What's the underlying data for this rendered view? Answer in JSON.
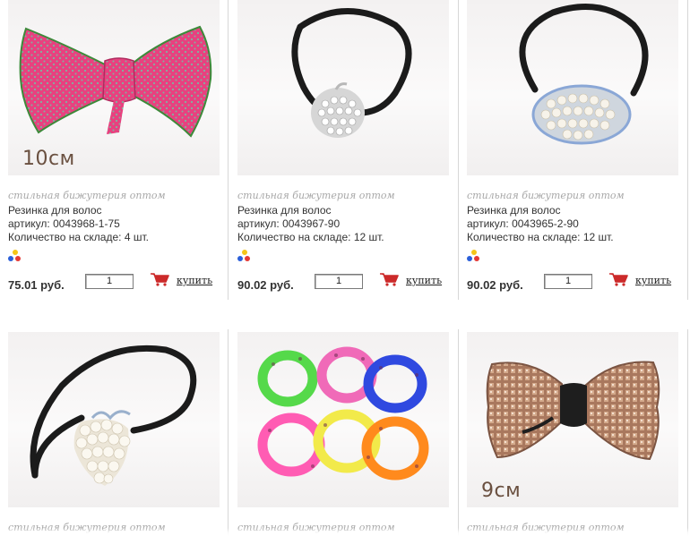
{
  "products": [
    {
      "tagline": "стильная бижутерия оптом",
      "name": "Резинка для волос",
      "article": "артикул: 0043968-1-75",
      "stock": "Количество на складе: 4 шт.",
      "price": "75.01 руб.",
      "qty": "1",
      "buy_label": "купить",
      "size_label": "10см",
      "image": "pink-polka-dot-bow"
    },
    {
      "tagline": "стильная бижутерия оптом",
      "name": "Резинка для волос",
      "article": "артикул: 0043967-90",
      "stock": "Количество на складе: 12 шт.",
      "price": "90.02 руб.",
      "qty": "1",
      "buy_label": "купить",
      "image": "black-elastic-crystal-apple"
    },
    {
      "tagline": "стильная бижутерия оптом",
      "name": "Резинка для волос",
      "article": "артикул: 0043965-2-90",
      "stock": "Количество на складе: 12 шт.",
      "price": "90.02 руб.",
      "qty": "1",
      "buy_label": "купить",
      "image": "black-elastic-pearl-oval"
    },
    {
      "tagline": "стильная бижутерия оптом",
      "image": "black-elastic-pearl-strawberry"
    },
    {
      "tagline": "стильная бижутерия оптом",
      "image": "colorful-hair-tie-set"
    },
    {
      "tagline": "стильная бижутерия оптом",
      "size_label": "9см",
      "image": "bronze-crystal-bow"
    }
  ],
  "colors": {
    "pink": "#e8417f",
    "elastic": "#1b1b1b",
    "cart_red": "#cc2a2a",
    "dot_red": "#e53935",
    "dot_yellow": "#f5c518",
    "dot_blue": "#2b5fd9"
  }
}
